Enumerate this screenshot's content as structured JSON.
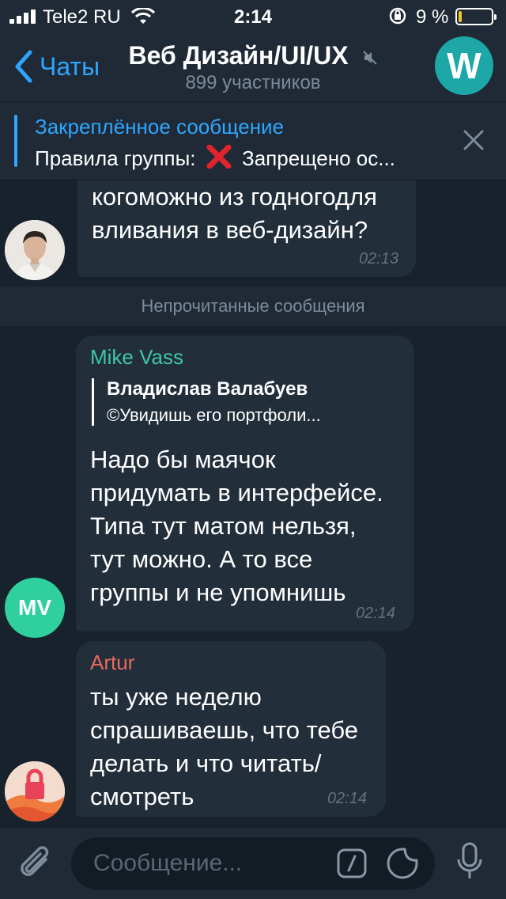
{
  "status": {
    "carrier": "Tele2 RU",
    "time": "2:14",
    "battery_pct": "9 %",
    "battery_level": 0.09
  },
  "nav": {
    "back_label": "Чаты",
    "title": "Веб Дизайн/UI/UX",
    "subtitle": "899 участников",
    "avatar_letter": "W",
    "avatar_color": "#1da7a7"
  },
  "pinned": {
    "title": "Закреплённое сообщение",
    "text_before": "Правила группы:",
    "text_after": "Запрещено ос..."
  },
  "messages": {
    "first": {
      "text_line1": "когоможно из годногодля",
      "text_line2": "вливания в веб-дизайн?",
      "time": "02:13"
    },
    "unread_label": "Непрочитанные сообщения",
    "mike": {
      "sender": "Mike Vass",
      "sender_color": "#3ec6a8",
      "avatar_initials": "MV",
      "avatar_color": "#2fcf9e",
      "reply_name": "Владислав Валабуев",
      "reply_text": "©Увидишь его портфоли...",
      "text_line1": "Надо бы маячок",
      "text_line2": "придумать в интерфейсе.",
      "text_line3": "Типа тут матом нельзя,",
      "text_line4": "тут можно. А то все",
      "text_line5": "группы и не упомнишь",
      "time": "02:14"
    },
    "artur": {
      "sender": "Artur",
      "sender_color": "#e8695f",
      "text_line1": "ты уже неделю",
      "text_line2": "спрашиваешь, что тебе",
      "text_line3": "делать и что читать/",
      "text_line4": "смотреть",
      "time": "02:14"
    }
  },
  "input": {
    "placeholder": "Сообщение..."
  },
  "colors": {
    "accent": "#2ea6ff",
    "bubble": "#222e3a",
    "background": "#18222d"
  }
}
